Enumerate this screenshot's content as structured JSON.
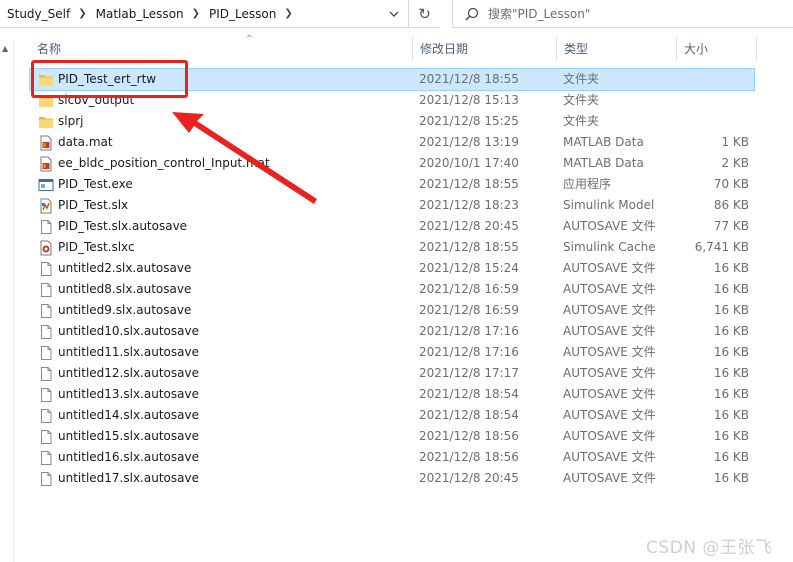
{
  "address": {
    "crumbs": [
      "Study_Self",
      "Matlab_Lesson",
      "PID_Lesson"
    ],
    "refresh_glyph": "↻"
  },
  "search": {
    "placeholder": "搜索\"PID_Lesson\"",
    "icon": "search-icon"
  },
  "columns": {
    "name": "名称",
    "date": "修改日期",
    "type": "类型",
    "size": "大小"
  },
  "files": [
    {
      "icon": "folder",
      "name": "PID_Test_ert_rtw",
      "date": "2021/12/8 18:55",
      "type": "文件夹",
      "size": ""
    },
    {
      "icon": "folder",
      "name": "slcov_output",
      "date": "2021/12/8 15:13",
      "type": "文件夹",
      "size": ""
    },
    {
      "icon": "folder",
      "name": "slprj",
      "date": "2021/12/8 15:25",
      "type": "文件夹",
      "size": ""
    },
    {
      "icon": "mat",
      "name": "data.mat",
      "date": "2021/12/8 13:19",
      "type": "MATLAB Data",
      "size": "1 KB"
    },
    {
      "icon": "mat",
      "name": "ee_bldc_position_control_Input.mat",
      "date": "2020/10/1 17:40",
      "type": "MATLAB Data",
      "size": "2 KB"
    },
    {
      "icon": "exe",
      "name": "PID_Test.exe",
      "date": "2021/12/8 18:55",
      "type": "应用程序",
      "size": "70 KB"
    },
    {
      "icon": "slx",
      "name": "PID_Test.slx",
      "date": "2021/12/8 18:23",
      "type": "Simulink Model",
      "size": "86 KB"
    },
    {
      "icon": "doc",
      "name": "PID_Test.slx.autosave",
      "date": "2021/12/8 20:45",
      "type": "AUTOSAVE 文件",
      "size": "77 KB"
    },
    {
      "icon": "slxc",
      "name": "PID_Test.slxc",
      "date": "2021/12/8 18:55",
      "type": "Simulink Cache",
      "size": "6,741 KB"
    },
    {
      "icon": "doc",
      "name": "untitled2.slx.autosave",
      "date": "2021/12/8 15:24",
      "type": "AUTOSAVE 文件",
      "size": "16 KB"
    },
    {
      "icon": "doc",
      "name": "untitled8.slx.autosave",
      "date": "2021/12/8 16:59",
      "type": "AUTOSAVE 文件",
      "size": "16 KB"
    },
    {
      "icon": "doc",
      "name": "untitled9.slx.autosave",
      "date": "2021/12/8 16:59",
      "type": "AUTOSAVE 文件",
      "size": "16 KB"
    },
    {
      "icon": "doc",
      "name": "untitled10.slx.autosave",
      "date": "2021/12/8 17:16",
      "type": "AUTOSAVE 文件",
      "size": "16 KB"
    },
    {
      "icon": "doc",
      "name": "untitled11.slx.autosave",
      "date": "2021/12/8 17:16",
      "type": "AUTOSAVE 文件",
      "size": "16 KB"
    },
    {
      "icon": "doc",
      "name": "untitled12.slx.autosave",
      "date": "2021/12/8 17:17",
      "type": "AUTOSAVE 文件",
      "size": "16 KB"
    },
    {
      "icon": "doc",
      "name": "untitled13.slx.autosave",
      "date": "2021/12/8 18:54",
      "type": "AUTOSAVE 文件",
      "size": "16 KB"
    },
    {
      "icon": "doc",
      "name": "untitled14.slx.autosave",
      "date": "2021/12/8 18:54",
      "type": "AUTOSAVE 文件",
      "size": "16 KB"
    },
    {
      "icon": "doc",
      "name": "untitled15.slx.autosave",
      "date": "2021/12/8 18:56",
      "type": "AUTOSAVE 文件",
      "size": "16 KB"
    },
    {
      "icon": "doc",
      "name": "untitled16.slx.autosave",
      "date": "2021/12/8 18:56",
      "type": "AUTOSAVE 文件",
      "size": "16 KB"
    },
    {
      "icon": "doc",
      "name": "untitled17.slx.autosave",
      "date": "2021/12/8 20:45",
      "type": "AUTOSAVE 文件",
      "size": "16 KB"
    }
  ],
  "selected_index": 0,
  "watermark": "CSDN @王张飞",
  "colors": {
    "selection": "#cce8ff",
    "annotation": "#e8231f",
    "folder": "#f8d775"
  }
}
